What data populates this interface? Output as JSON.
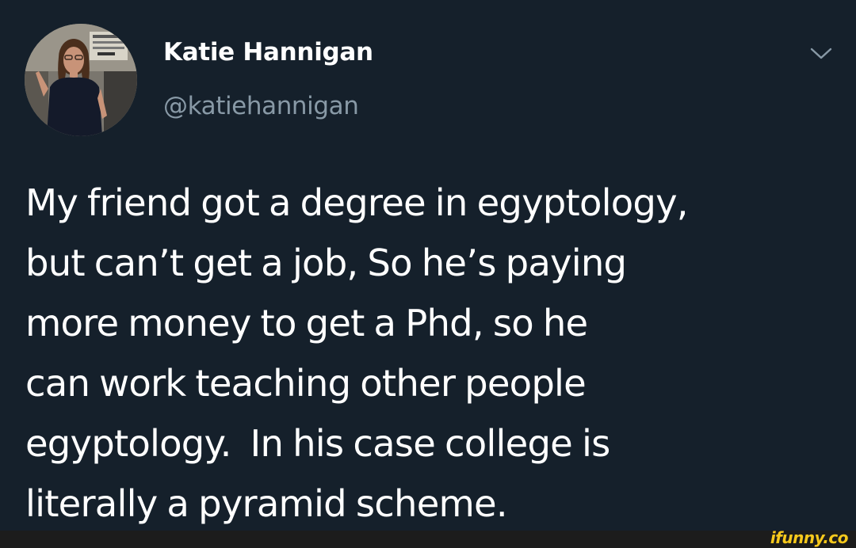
{
  "tweet": {
    "display_name": "Katie Hannigan",
    "handle": "@katiehannigan",
    "avatar_icon": "profile-photo",
    "menu_icon": "chevron-down-icon",
    "text_lines": [
      "My friend got a degree in egyptology,",
      "but can’t get a job, So he’s paying",
      "more money to get a Phd, so he",
      "can work teaching other people",
      "egyptology.  In his case college is",
      "literally a pyramid scheme."
    ]
  },
  "watermark": "ifunny.co",
  "colors": {
    "background": "#15202b",
    "text_primary": "#ffffff",
    "text_secondary": "#8899a6",
    "watermark": "#f8c91c"
  }
}
